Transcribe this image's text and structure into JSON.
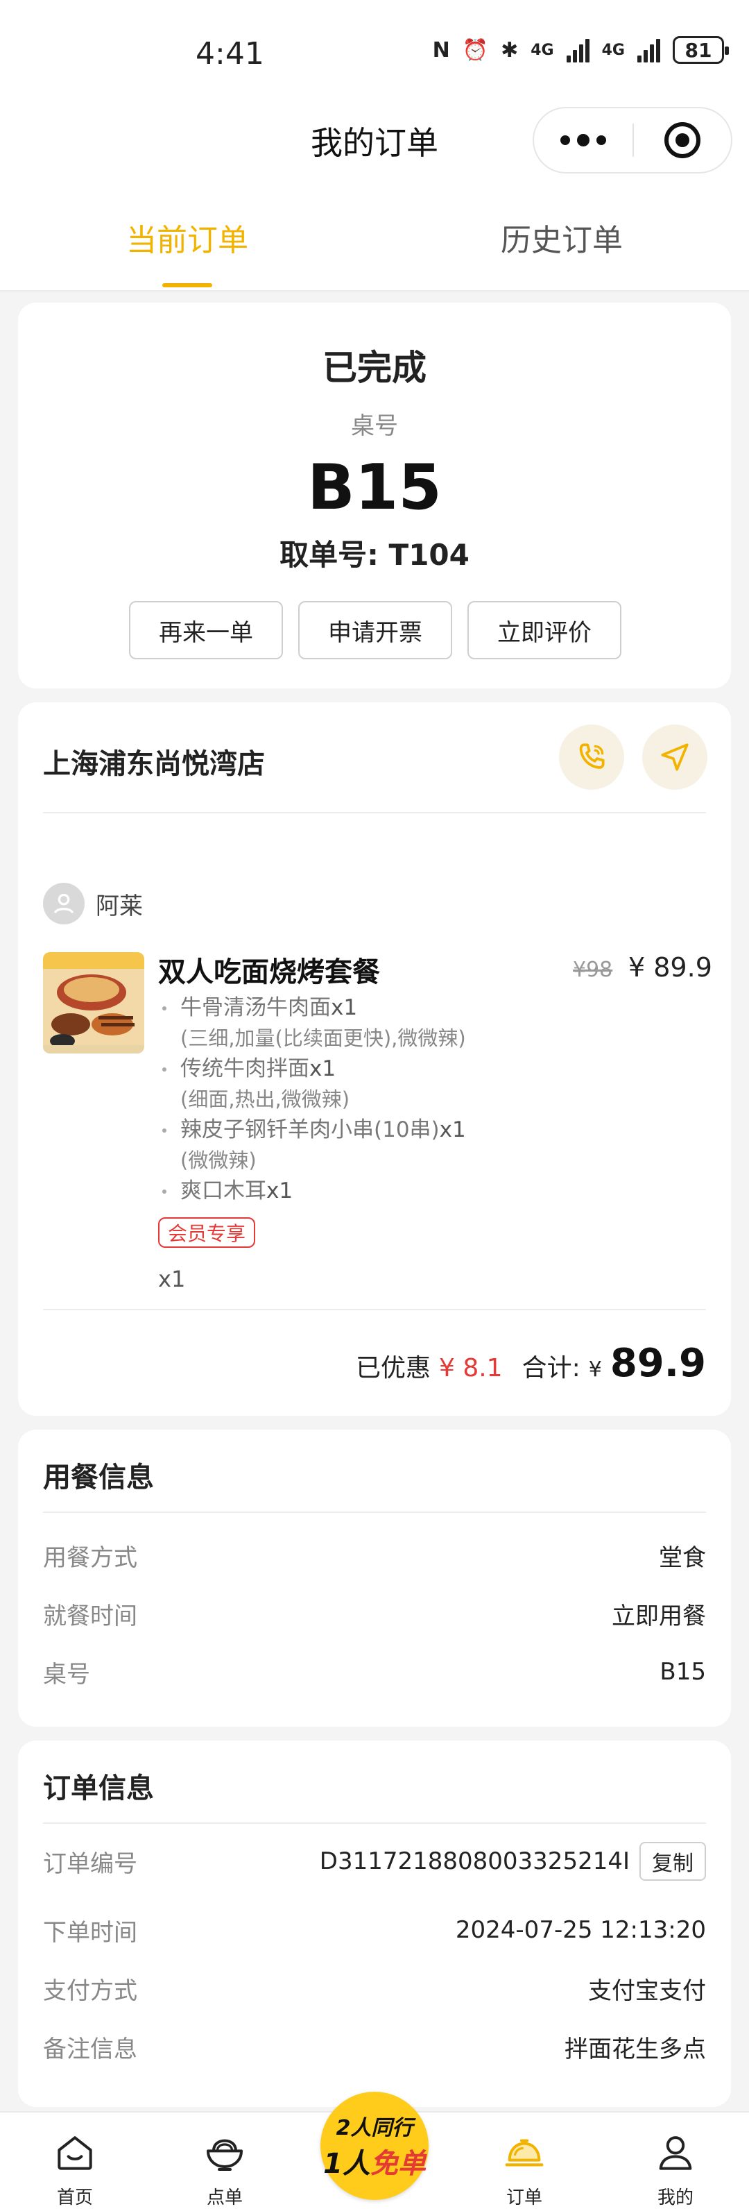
{
  "status_bar": {
    "time": "4:41",
    "network1": "4G",
    "network2": "4G",
    "battery": "81"
  },
  "navbar": {
    "title": "我的订单"
  },
  "tabs": [
    {
      "label": "当前订单"
    },
    {
      "label": "历史订单"
    }
  ],
  "order_status": {
    "status": "已完成",
    "table_label": "桌号",
    "table_no": "B15",
    "pickup": "取单号: T104",
    "buttons": [
      "再来一单",
      "申请开票",
      "立即评价"
    ]
  },
  "store": {
    "name": "上海浦东尚悦湾店",
    "user_name": "阿莱",
    "product": {
      "name": "双人吃面烧烤套餐",
      "old_price": "¥98",
      "price": "¥ 89.9",
      "items": [
        {
          "name": "牛骨清汤牛肉面",
          "qty": "x1",
          "spec": "(三细,加量(比续面更快),微微辣)"
        },
        {
          "name": "传统牛肉拌面",
          "qty": "x1",
          "spec": "(细面,热出,微微辣)"
        },
        {
          "name": "辣皮子钢钎羊肉小串(10串)",
          "qty": "x1",
          "spec": "(微微辣)"
        },
        {
          "name": "爽口木耳",
          "qty": "x1",
          "spec": ""
        }
      ],
      "badge": "会员专享",
      "bundle_qty": "x1"
    },
    "discount_label": "已优惠",
    "discount": "¥ 8.1",
    "total_label": "合计:",
    "currency": "¥",
    "total": "89.9"
  },
  "dining_info": {
    "title": "用餐信息",
    "rows": [
      {
        "k": "用餐方式",
        "v": "堂食"
      },
      {
        "k": "就餐时间",
        "v": "立即用餐"
      },
      {
        "k": "桌号",
        "v": "B15"
      }
    ]
  },
  "order_info": {
    "title": "订单信息",
    "rows": [
      {
        "k": "订单编号",
        "v": "D3117218808003325214I"
      },
      {
        "k": "下单时间",
        "v": "2024-07-25 12:13:20"
      },
      {
        "k": "支付方式",
        "v": "支付宝支付"
      },
      {
        "k": "备注信息",
        "v": "拌面花生多点"
      }
    ],
    "copy_label": "复制"
  },
  "bottom_nav": {
    "items": [
      {
        "label": "首页"
      },
      {
        "label": "点单"
      },
      {
        "label": "订单"
      },
      {
        "label": "我的"
      }
    ],
    "promo_line1": "2人同行",
    "promo_line2a": "1人",
    "promo_line2b": "免单"
  },
  "colors": {
    "accent": "#f2b300",
    "red": "#e53935"
  }
}
